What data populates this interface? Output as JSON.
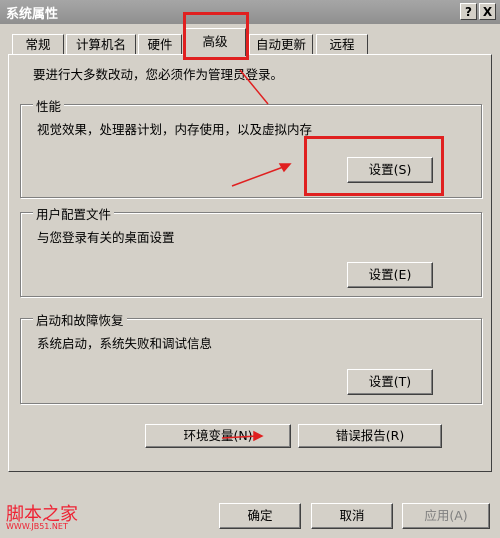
{
  "window": {
    "title": "系统属性",
    "help_btn": "?",
    "close_btn": "X"
  },
  "tabs": [
    {
      "label": "常规"
    },
    {
      "label": "计算机名"
    },
    {
      "label": "硬件"
    },
    {
      "label": "高级",
      "active": true
    },
    {
      "label": "自动更新"
    },
    {
      "label": "远程"
    }
  ],
  "notice": "要进行大多数改动，您必须作为管理员登录。",
  "groups": {
    "performance": {
      "title": "性能",
      "desc": "视觉效果，处理器计划，内存使用，以及虚拟内存",
      "button": "设置(S)"
    },
    "profiles": {
      "title": "用户配置文件",
      "desc": "与您登录有关的桌面设置",
      "button": "设置(E)"
    },
    "startup": {
      "title": "启动和故障恢复",
      "desc": "系统启动，系统失败和调试信息",
      "button": "设置(T)"
    }
  },
  "bottom_buttons": {
    "env": "环境变量(N)",
    "error_report": "错误报告(R)"
  },
  "footer_buttons": {
    "ok": "确定",
    "cancel": "取消",
    "apply": "应用(A)"
  },
  "watermark": {
    "text": "脚本之家",
    "url": "WWW.JB51.NET"
  },
  "colors": {
    "annotation": "#e02020",
    "face": "#d4d0c8"
  }
}
